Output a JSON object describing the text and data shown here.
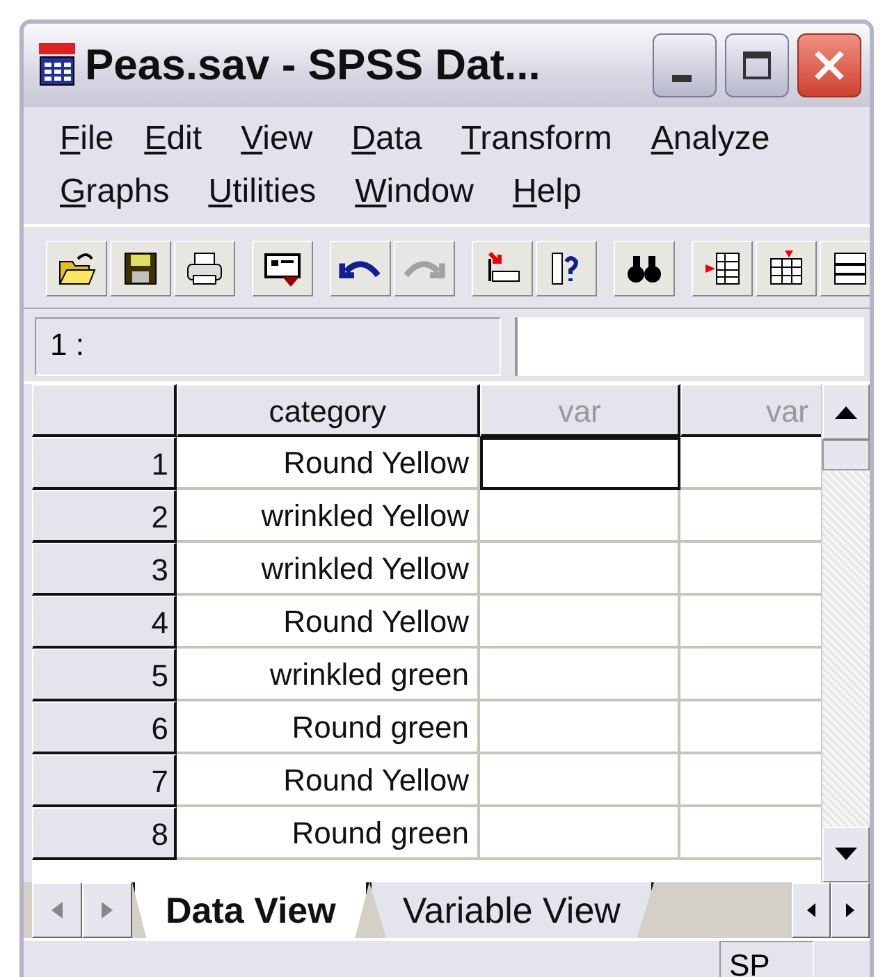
{
  "window": {
    "title": "Peas.sav - SPSS Dat..."
  },
  "menu": [
    {
      "key": "F",
      "rest": "ile"
    },
    {
      "key": "E",
      "rest": "dit"
    },
    {
      "key": "V",
      "rest": "iew"
    },
    {
      "key": "D",
      "rest": "ata"
    },
    {
      "key": "T",
      "rest": "ransform"
    },
    {
      "key": "A",
      "rest": "nalyze"
    },
    {
      "key": "G",
      "rest": "raphs"
    },
    {
      "key": "U",
      "rest": "tilities"
    },
    {
      "key": "W",
      "rest": "indow"
    },
    {
      "key": "H",
      "rest": "elp"
    }
  ],
  "toolbar": [
    {
      "buttons": [
        {
          "kind": "open",
          "disabled": false
        },
        {
          "kind": "save",
          "disabled": false
        },
        {
          "kind": "print",
          "disabled": false
        }
      ]
    },
    {
      "buttons": [
        {
          "kind": "dialog",
          "disabled": false
        }
      ]
    },
    {
      "buttons": [
        {
          "kind": "undo",
          "disabled": false
        },
        {
          "kind": "redo",
          "disabled": true
        }
      ]
    },
    {
      "buttons": [
        {
          "kind": "goto",
          "disabled": false
        },
        {
          "kind": "variables",
          "disabled": false
        }
      ]
    },
    {
      "buttons": [
        {
          "kind": "find",
          "disabled": false
        }
      ]
    },
    {
      "buttons": [
        {
          "kind": "insert-case",
          "disabled": false
        },
        {
          "kind": "insert-variable",
          "disabled": false
        },
        {
          "kind": "split",
          "disabled": false
        }
      ]
    }
  ],
  "cell_editor": {
    "label": "1 :"
  },
  "grid": {
    "columns": [
      {
        "label": "category",
        "kind": "variable"
      },
      {
        "label": "var",
        "kind": "empty"
      },
      {
        "label": "var",
        "kind": "empty"
      }
    ],
    "rows": [
      {
        "number": "1",
        "cells": [
          {
            "text": "Round Yellow",
            "selected": false
          },
          {
            "selected": true
          },
          {
            "selected": false
          }
        ]
      },
      {
        "number": "2",
        "cells": [
          {
            "text": "wrinkled Yellow",
            "selected": false
          },
          {
            "selected": false
          },
          {
            "selected": false
          }
        ]
      },
      {
        "number": "3",
        "cells": [
          {
            "text": "wrinkled Yellow",
            "selected": false
          },
          {
            "selected": false
          },
          {
            "selected": false
          }
        ]
      },
      {
        "number": "4",
        "cells": [
          {
            "text": "Round Yellow",
            "selected": false
          },
          {
            "selected": false
          },
          {
            "selected": false
          }
        ]
      },
      {
        "number": "5",
        "cells": [
          {
            "text": "wrinkled green",
            "selected": false
          },
          {
            "selected": false
          },
          {
            "selected": false
          }
        ]
      },
      {
        "number": "6",
        "cells": [
          {
            "text": "Round green",
            "selected": false
          },
          {
            "selected": false
          },
          {
            "selected": false
          }
        ]
      },
      {
        "number": "7",
        "cells": [
          {
            "text": "Round Yellow",
            "selected": false
          },
          {
            "selected": false
          },
          {
            "selected": false
          }
        ]
      },
      {
        "number": "8",
        "cells": [
          {
            "text": "Round green",
            "selected": false
          },
          {
            "selected": false
          },
          {
            "selected": false
          }
        ]
      }
    ]
  },
  "tabs": [
    {
      "label": "Data View",
      "selected": true
    },
    {
      "label": "Variable View",
      "selected": false
    }
  ],
  "status_bar": {
    "text": "SP"
  }
}
